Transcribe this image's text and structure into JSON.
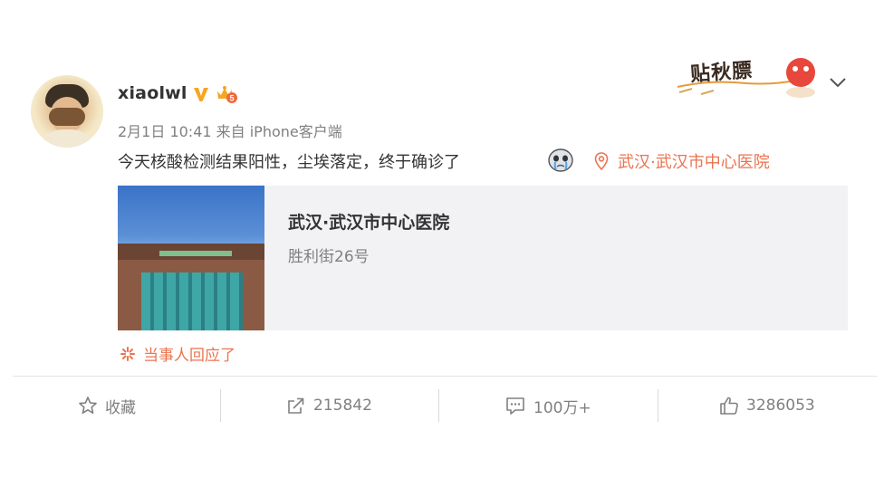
{
  "post": {
    "username": "xiaolwl",
    "meta": "2月1日 10:41 来自 iPhone客户端",
    "text": "今天核酸检测结果阳性，尘埃落定，终于确诊了",
    "location_tag": "武汉·武汉市中心医院",
    "reply_note": "当事人回应了"
  },
  "location_card": {
    "name": "武汉·武汉市中心医院",
    "address": "胜利街26号"
  },
  "sticker": {
    "text": "贴秋膘"
  },
  "actions": {
    "favorite_label": "收藏",
    "repost_count": "215842",
    "comment_count": "100万+",
    "like_count": "3286053"
  },
  "colors": {
    "accent": "#eb7350",
    "text": "#333333",
    "muted": "#808080",
    "card_bg": "#f2f2f5",
    "verified": "#f5a623"
  },
  "icons": [
    "verified-v-icon",
    "vip-crown-icon",
    "crying-face-emoji-icon",
    "location-pin-icon",
    "asterisk-icon",
    "star-icon",
    "repost-icon",
    "comment-icon",
    "thumbs-up-icon",
    "chevron-down-icon"
  ]
}
